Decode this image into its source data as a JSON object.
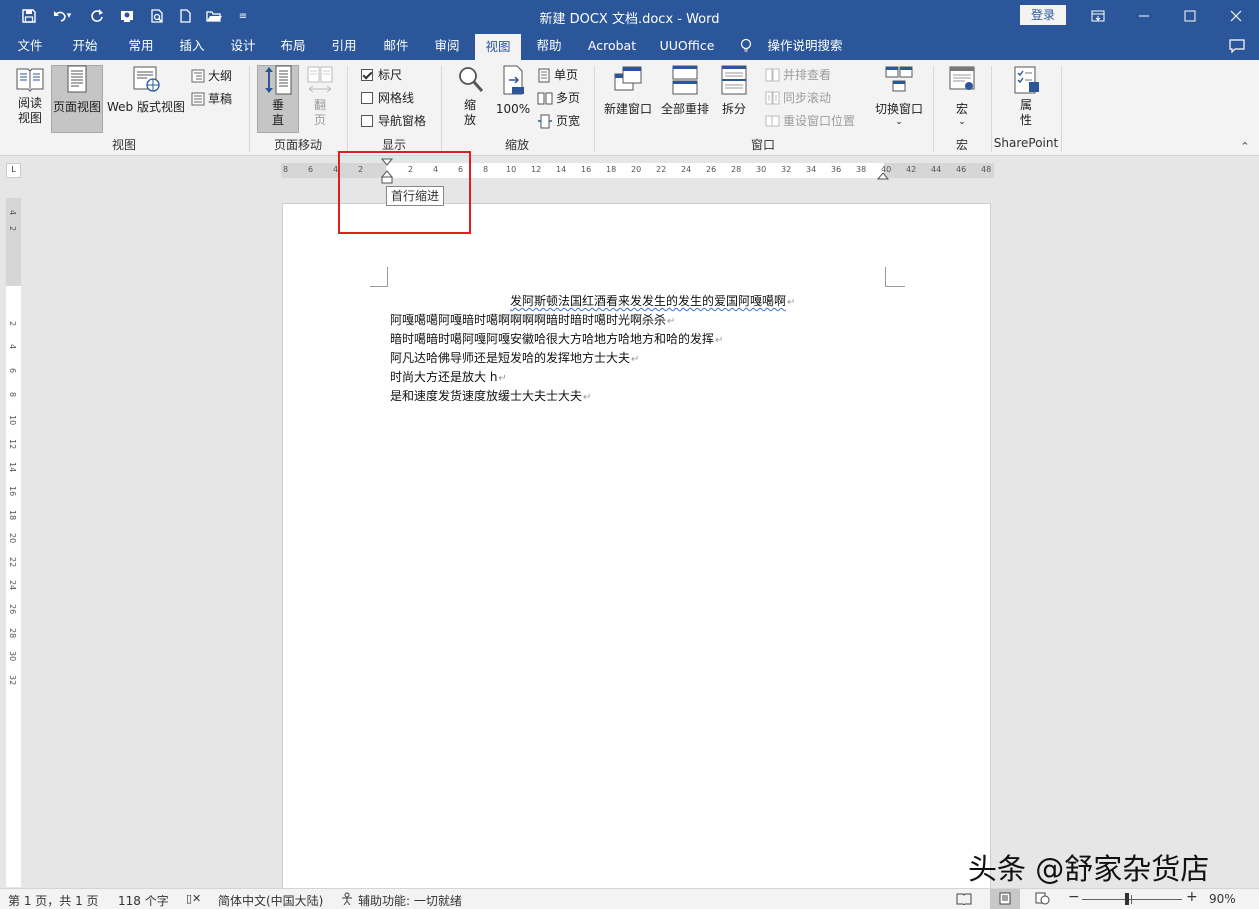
{
  "titlebar": {
    "title": "新建 DOCX 文档.docx  -  Word",
    "login_label": "登录",
    "quick_access_icons": [
      "save-icon",
      "undo-icon",
      "redo-icon",
      "touch-mode-icon",
      "print-preview-icon",
      "new-document-icon",
      "open-folder-icon",
      "customize-quick-access-icon"
    ]
  },
  "tabs": [
    "文件",
    "开始",
    "常用",
    "插入",
    "设计",
    "布局",
    "引用",
    "邮件",
    "审阅",
    "视图",
    "帮助",
    "Acrobat",
    "UUOffice",
    "操作说明搜索"
  ],
  "active_tab": "视图",
  "ribbon": {
    "views": {
      "read_mode": "阅读\n视图",
      "read_mode_1": "阅读",
      "read_mode_2": "视图",
      "print_layout": "页面视图",
      "web_layout": "Web 版式视图",
      "outline": "大纲",
      "draft": "草稿",
      "group": "视图"
    },
    "page_movement": {
      "vertical_1": "垂",
      "vertical_2": "直",
      "side_1": "翻",
      "side_2": "页",
      "group": "页面移动"
    },
    "show": {
      "ruler": "标尺",
      "gridlines": "网格线",
      "nav_pane": "导航窗格",
      "group": "显示",
      "ruler_checked": true,
      "gridlines_checked": false,
      "nav_pane_checked": false
    },
    "zoom": {
      "zoom_1": "缩",
      "zoom_2": "放",
      "percent": "100%",
      "one_page": "单页",
      "multi_page": "多页",
      "page_width": "页宽",
      "group": "缩放"
    },
    "window": {
      "new_window": "新建窗口",
      "arrange_all": "全部重排",
      "split": "拆分",
      "side_by_side": "并排查看",
      "sync_scroll": "同步滚动",
      "reset_position": "重设窗口位置",
      "switch_windows": "切换窗口",
      "group": "窗口"
    },
    "macros": {
      "label": "宏",
      "group": "宏"
    },
    "sharepoint": {
      "props_1": "属",
      "props_2": "性",
      "group": "SharePoint"
    }
  },
  "ruler": {
    "left_numbers": [
      "8",
      "6",
      "4",
      "2"
    ],
    "right_numbers": [
      "2",
      "4",
      "6",
      "8",
      "10",
      "12",
      "14",
      "16",
      "18",
      "20",
      "22",
      "24",
      "26",
      "28",
      "30",
      "32",
      "34",
      "36",
      "38",
      "40",
      "42",
      "44",
      "46",
      "48"
    ],
    "vertical_numbers": [
      "4",
      "2",
      "",
      "2",
      "4",
      "6",
      "8",
      "10",
      "12",
      "14",
      "16",
      "18",
      "20",
      "22",
      "24",
      "26",
      "28",
      "30",
      "32"
    ],
    "tooltip": "首行缩进",
    "highlight_color": "#e02020"
  },
  "document": {
    "lines": [
      "发阿斯顿法国红酒看来发发生的发生的爱国阿嘎噶啊",
      "阿嘎噶噶阿嘎暗时噶啊啊啊啊暗时暗时噶时光啊杀杀",
      "暗时噶暗时噶阿嘎阿嘎安徽哈很大方哈地方哈地方和哈的发挥",
      "阿凡达哈佛导师还是短发哈的发挥地方士大夫",
      "时尚大方还是放大 h",
      "是和速度发货速度放缓士大夫士大夫"
    ]
  },
  "statusbar": {
    "page": "第 1 页，共 1 页",
    "words": "118 个字",
    "language": "简体中文(中国大陆)",
    "accessibility": "辅助功能: 一切就绪",
    "zoom": "90%",
    "zoom_level": 0.45
  },
  "watermark": "头条 @舒家杂货店",
  "colors": {
    "brand": "#2b579a",
    "ribbon": "#f3f3f3",
    "active_button": "#c5c5c5",
    "highlight": "#e02020"
  }
}
